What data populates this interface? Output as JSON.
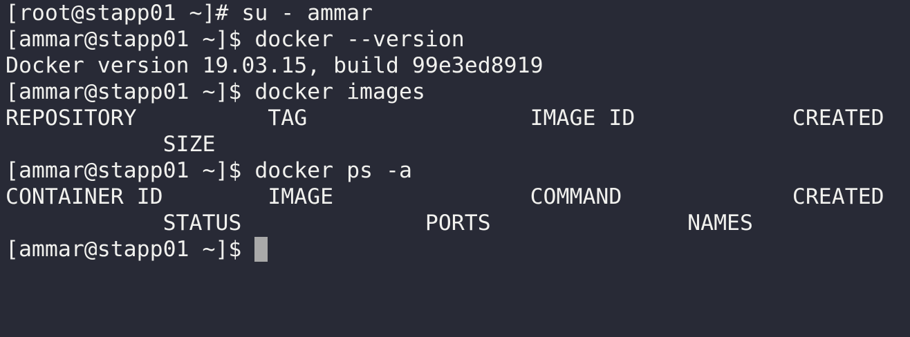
{
  "terminal": {
    "lines": [
      "[root@stapp01 ~]# su - ammar",
      "[ammar@stapp01 ~]$ docker --version",
      "Docker version 19.03.15, build 99e3ed8919",
      "[ammar@stapp01 ~]$ docker images",
      "REPOSITORY          TAG                 IMAGE ID            CREATED",
      "            SIZE",
      "[ammar@stapp01 ~]$ docker ps -a",
      "CONTAINER ID        IMAGE               COMMAND             CREATED",
      "            STATUS              PORTS               NAMES",
      "[ammar@stapp01 ~]$ "
    ],
    "colors": {
      "background": "#282a36",
      "foreground": "#f1f1ee",
      "cursor": "#a9a9a9"
    }
  }
}
